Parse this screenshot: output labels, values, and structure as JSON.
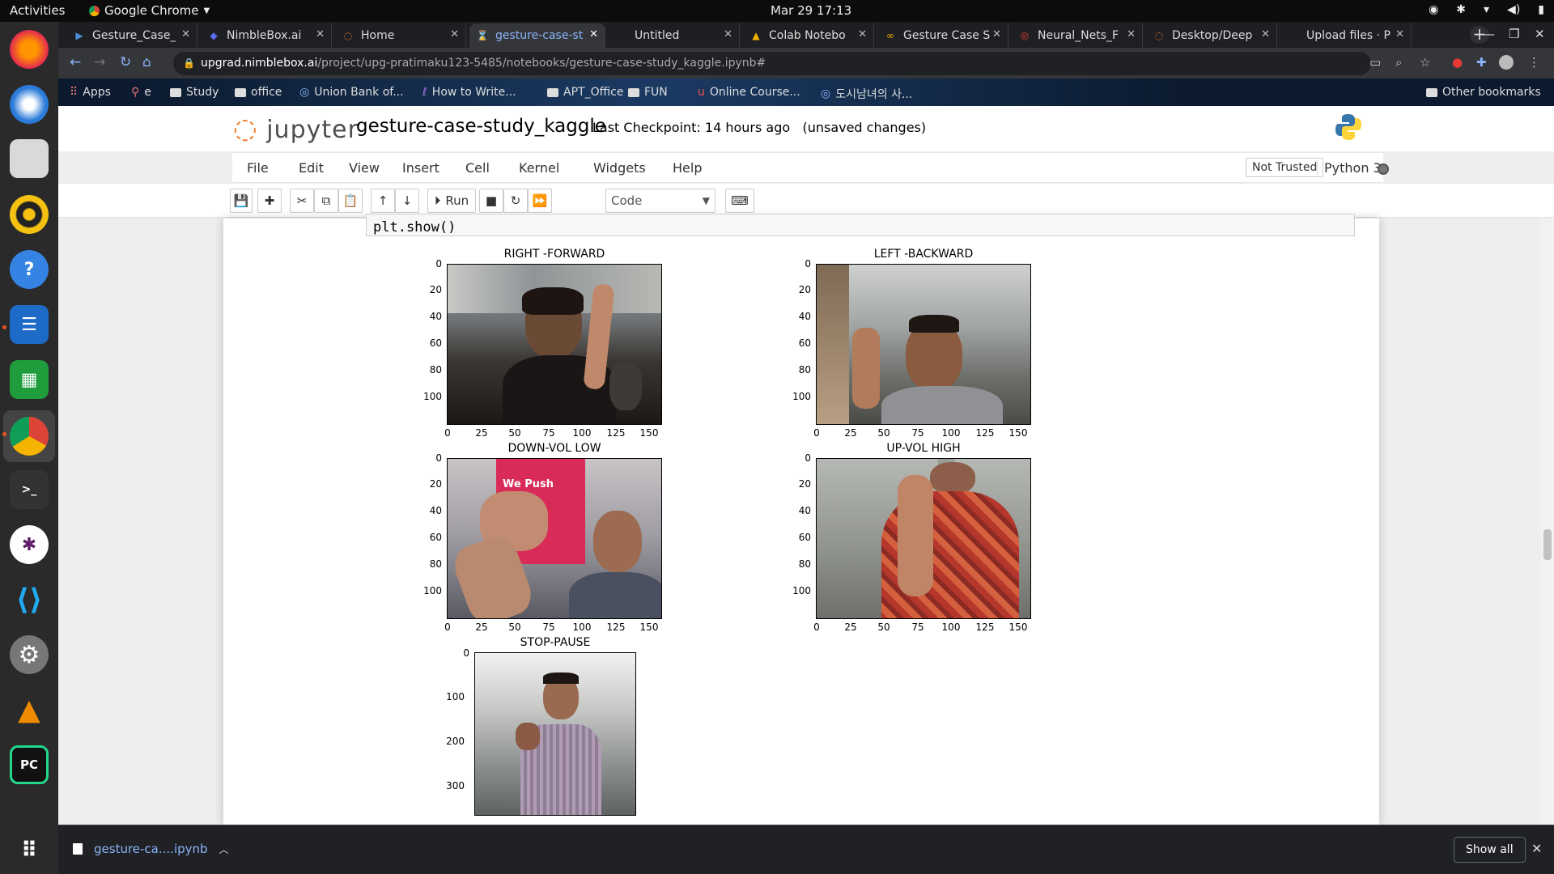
{
  "system": {
    "activities": "Activities",
    "app_name": "Google Chrome",
    "clock": "Mar 29  17:13"
  },
  "browser": {
    "tabs": [
      {
        "title": "Gesture_Case_",
        "favicon": "play-icon"
      },
      {
        "title": "NimbleBox.ai",
        "favicon": "nimblebox-icon"
      },
      {
        "title": "Home",
        "favicon": "jupyter-icon"
      },
      {
        "title": "gesture-case-st",
        "favicon": "jupyter-icon",
        "active": true
      },
      {
        "title": "Untitled",
        "favicon": "blank-icon"
      },
      {
        "title": "Colab Notebo",
        "favicon": "drive-icon"
      },
      {
        "title": "Gesture Case S",
        "favicon": "colab-icon"
      },
      {
        "title": "Neural_Nets_F",
        "favicon": "coursera-icon"
      },
      {
        "title": "Desktop/Deep",
        "favicon": "jupyter-icon"
      },
      {
        "title": "Upload files · P",
        "favicon": "blank-icon"
      }
    ],
    "url_host": "upgrad.nimblebox.ai",
    "url_path": "/project/upg-pratimaku123-5485/notebooks/gesture-case-study_kaggle.ipynb#",
    "bookmarks": [
      "Apps",
      "e",
      "Study",
      "office",
      "Union Bank of...",
      "How to Write...",
      "APT_Office",
      "FUN",
      "Online Course...",
      "도시남녀의 사..."
    ],
    "other_bookmarks": "Other bookmarks"
  },
  "jupyter": {
    "logo_text": "jupyter",
    "notebook_name": "gesture-case-study_kaggle",
    "checkpoint": "Last Checkpoint: 14 hours ago",
    "unsaved": "(unsaved changes)",
    "menus": [
      "File",
      "Edit",
      "View",
      "Insert",
      "Cell",
      "Kernel",
      "Widgets",
      "Help"
    ],
    "trust": "Not Trusted",
    "kernel": "Python 3",
    "run_label": "Run",
    "cell_type": "Code",
    "code_line": "plt.show()"
  },
  "subplots": [
    {
      "title": "RIGHT -FORWARD",
      "yticks": [
        "0",
        "20",
        "40",
        "60",
        "80",
        "100"
      ],
      "xticks": [
        "0",
        "25",
        "50",
        "75",
        "100",
        "125",
        "150"
      ]
    },
    {
      "title": "LEFT -BACKWARD",
      "yticks": [
        "0",
        "20",
        "40",
        "60",
        "80",
        "100"
      ],
      "xticks": [
        "0",
        "25",
        "50",
        "75",
        "100",
        "125",
        "150"
      ]
    },
    {
      "title": "DOWN-VOL LOW",
      "yticks": [
        "0",
        "20",
        "40",
        "60",
        "80",
        "100"
      ],
      "xticks": [
        "0",
        "25",
        "50",
        "75",
        "100",
        "125",
        "150"
      ]
    },
    {
      "title": "UP-VOL HIGH",
      "yticks": [
        "0",
        "20",
        "40",
        "60",
        "80",
        "100"
      ],
      "xticks": [
        "0",
        "25",
        "50",
        "75",
        "100",
        "125",
        "150"
      ]
    },
    {
      "title": "STOP-PAUSE",
      "yticks": [
        "0",
        "100",
        "200",
        "300"
      ],
      "xticks": []
    }
  ],
  "image_text": {
    "sign": "We Push"
  },
  "download": {
    "filename": "gesture-ca....ipynb",
    "show_all": "Show all"
  }
}
